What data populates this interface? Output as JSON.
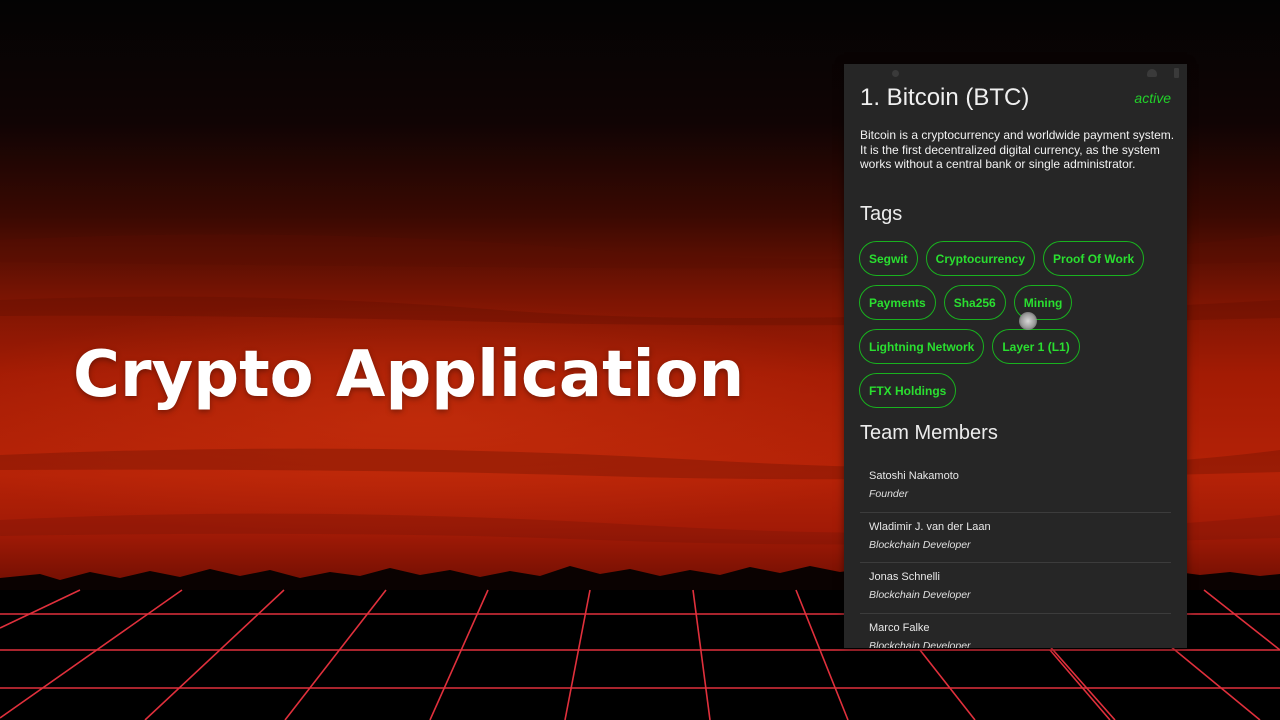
{
  "slide": {
    "headline": "Crypto Application"
  },
  "colors": {
    "accent_green": "#2adf30",
    "tag_border": "#19b21f",
    "panel_bg": "#262626",
    "sky_red": "#b71e06",
    "grid_line": "#e0303c"
  },
  "app": {
    "coin_title": "1. Bitcoin (BTC)",
    "status": "active",
    "description": "Bitcoin is a cryptocurrency and worldwide payment system. It is the first decentralized digital currency, as the system works without a central bank or single administrator.",
    "tags_heading": "Tags",
    "tags": [
      [
        "Segwit",
        "Cryptocurrency",
        "Proof Of Work"
      ],
      [
        "Payments",
        "Sha256",
        "Mining"
      ],
      [
        "Lightning Network",
        "Layer 1 (L1)"
      ],
      [
        "FTX Holdings"
      ]
    ],
    "team_heading": "Team Members",
    "team": [
      {
        "name": "Satoshi Nakamoto",
        "role": "Founder"
      },
      {
        "name": "Wladimir J. van der Laan",
        "role": "Blockchain Developer"
      },
      {
        "name": "Jonas Schnelli",
        "role": "Blockchain Developer"
      },
      {
        "name": "Marco Falke",
        "role": "Blockchain Developer"
      }
    ]
  }
}
